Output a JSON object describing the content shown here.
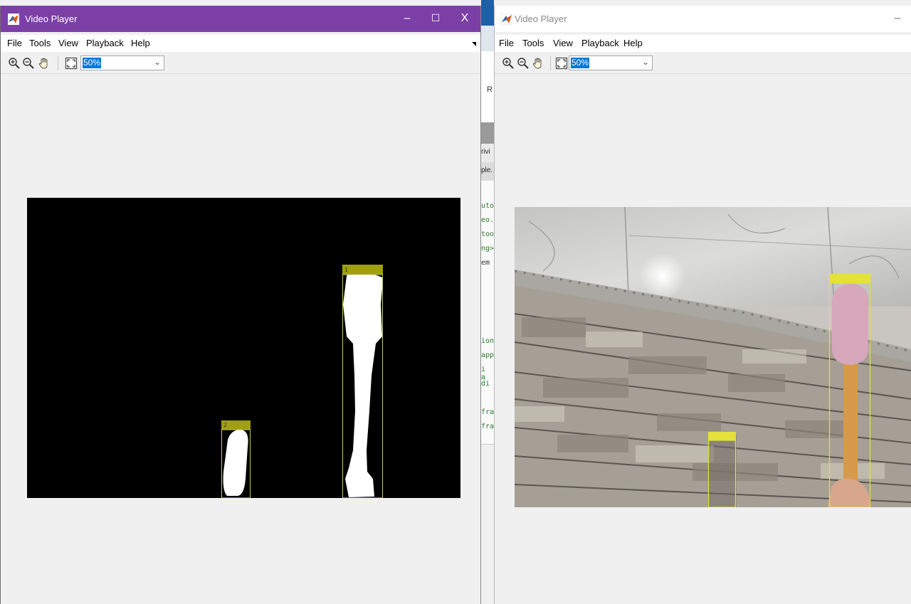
{
  "left_window": {
    "title": "Video Player",
    "menu": [
      "File",
      "Tools",
      "View",
      "Playback",
      "Help"
    ],
    "zoom_value": "50%",
    "window_controls": {
      "minimize": "–",
      "maximize": "☐",
      "close": "X"
    }
  },
  "background_app": {
    "code_fragments": [
      "rivi",
      "ple.",
      "uto",
      "eo.",
      "too",
      "ng>",
      "em",
      "ion",
      "app",
      "i a",
      " di",
      "fra",
      "fra",
      "R"
    ]
  },
  "right_window": {
    "title": "Video Player",
    "menu": [
      "File",
      "Tools",
      "View",
      "Playback",
      "Help"
    ],
    "zoom_value": "50%",
    "window_controls": {
      "minimize": "–"
    }
  },
  "colors": {
    "left_titlebar": "#7b3fa6",
    "detection_label": "#d8d83a",
    "detection_box": "#e6e64a",
    "mask_white": "#ffffff",
    "zoom_highlight": "#0078d7"
  },
  "icons": [
    "matlab-icon",
    "zoom-in-icon",
    "zoom-out-icon",
    "pan-hand-icon",
    "fit-to-window-icon",
    "chevron-down-icon"
  ]
}
